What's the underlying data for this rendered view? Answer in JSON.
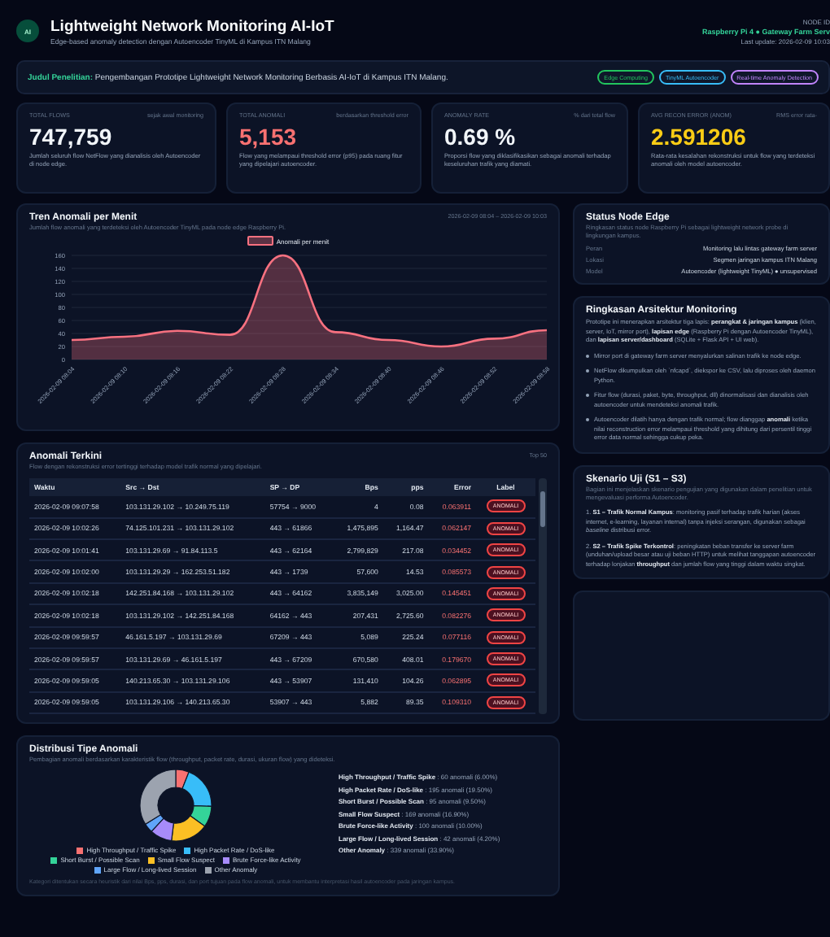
{
  "header": {
    "logo": "AI",
    "title": "Lightweight Network Monitoring AI-IoT",
    "subtitle": "Edge-based anomaly detection dengan Autoencoder TinyML di Kampus ITN Malang",
    "node_label": "NODE ID",
    "node": "Raspberry Pi 4 ● Gateway Farm Serv",
    "updated": "Last update: 2026-02-09 10:03"
  },
  "banner": {
    "text": "**Judul Penelitian:** Pengembangan Prototipe Lightweight Network Monitoring Berbasis AI-IoT di Kampus ITN Malang.",
    "tags": [
      {
        "label": "Edge Computing",
        "color": "#22c55e"
      },
      {
        "label": "TinyML Autoencoder",
        "color": "#38bdf8"
      },
      {
        "label": "Real-time Anomaly Detection",
        "color": "#c084fc"
      }
    ]
  },
  "stats": [
    {
      "label": "TOTAL FLOWS",
      "note": "sejak awal monitoring",
      "value": "747,759",
      "color": "#f1f5f9",
      "desc": "Jumlah seluruh flow NetFlow yang dianalisis oleh Autoencoder di node edge."
    },
    {
      "label": "TOTAL ANOMALI",
      "note": "berdasarkan threshold error",
      "value": "5,153",
      "color": "#f87171",
      "desc": "Flow yang melampaui threshold error (p95) pada ruang fitur yang dipelajari autoencoder."
    },
    {
      "label": "ANOMALY RATE",
      "note": "% dari total flow",
      "value": "0.69 %",
      "color": "#f1f5f9",
      "desc": "Proporsi flow yang diklasifikasikan sebagai anomali terhadap keseluruhan trafik yang diamati."
    },
    {
      "label": "AVG RECON ERROR (ANOM)",
      "note": "RMS error rata-",
      "value": "2.591206",
      "color": "#facc15",
      "desc": "Rata-rata kesalahan rekonstruksi untuk flow yang terdeteksi anomali oleh model autoencoder."
    }
  ],
  "trend": {
    "title": "Tren Anomali per Menit",
    "subtitle": "Jumlah flow anomali yang terdeteksi oleh Autoencoder TinyML pada node edge Raspberry Pi.",
    "range": "2026-02-09 08:04 – 2026-02-09 10:03",
    "chart_data": {
      "type": "area",
      "grid": true,
      "ylim": [
        0,
        160
      ],
      "yticks": [
        0,
        20,
        40,
        60,
        80,
        100,
        120,
        140,
        160
      ],
      "categories": [
        "2026-02-09 08:04",
        "2026-02-09 08:10",
        "2026-02-09 08:16",
        "2026-02-09 08:22",
        "2026-02-09 08:28",
        "2026-02-09 08:34",
        "2026-02-09 08:40",
        "2026-02-09 08:46",
        "2026-02-09 08:52",
        "2026-02-09 08:58"
      ],
      "series": [
        {
          "name": "Anomali per menit",
          "color": "#f87180",
          "values": [
            30,
            35,
            44,
            38,
            160,
            42,
            30,
            20,
            32,
            45
          ]
        }
      ]
    }
  },
  "table": {
    "title": "Anomali Terkini",
    "subtitle": "Flow dengan rekonstruksi error tertinggi terhadap model trafik normal yang dipelajari.",
    "badge": "Top 50",
    "columns": [
      "Waktu",
      "Src → Dst",
      "SP → DP",
      "Bps",
      "pps",
      "Error",
      "Label"
    ],
    "rows": [
      {
        "cells": [
          "2026-02-09 09:07:58",
          "103.131.29.102 → 10.249.75.119",
          "57754 → 9000",
          "4",
          "0.08",
          "0.063911"
        ],
        "label": "ANOMALI"
      },
      {
        "cells": [
          "2026-02-09 10:02:26",
          "74.125.101.231 → 103.131.29.102",
          "443 → 61866",
          "1,475,895",
          "1,164.47",
          "0.062147"
        ],
        "label": "ANOMALI"
      },
      {
        "cells": [
          "2026-02-09 10:01:41",
          "103.131.29.69 → 91.84.113.5",
          "443 → 62164",
          "2,799,829",
          "217.08",
          "0.034452"
        ],
        "label": "ANOMALI"
      },
      {
        "cells": [
          "2026-02-09 10:02:00",
          "103.131.29.29 → 162.253.51.182",
          "443 → 1739",
          "57,600",
          "14.53",
          "0.085573"
        ],
        "label": "ANOMALI"
      },
      {
        "cells": [
          "2026-02-09 10:02:18",
          "142.251.84.168 → 103.131.29.102",
          "443 → 64162",
          "3,835,149",
          "3,025.00",
          "0.145451"
        ],
        "label": "ANOMALI"
      },
      {
        "cells": [
          "2026-02-09 10:02:18",
          "103.131.29.102 → 142.251.84.168",
          "64162 → 443",
          "207,431",
          "2,725.60",
          "0.082276"
        ],
        "label": "ANOMALI"
      },
      {
        "cells": [
          "2026-02-09 09:59:57",
          "46.161.5.197 → 103.131.29.69",
          "67209 → 443",
          "5,089",
          "225.24",
          "0.077116"
        ],
        "label": "ANOMALI"
      },
      {
        "cells": [
          "2026-02-09 09:59:57",
          "103.131.29.69 → 46.161.5.197",
          "443 → 67209",
          "670,580",
          "408.01",
          "0.179670"
        ],
        "label": "ANOMALI"
      },
      {
        "cells": [
          "2026-02-09 09:59:05",
          "140.213.65.30 → 103.131.29.106",
          "443 → 53907",
          "131,410",
          "104.26",
          "0.062895"
        ],
        "label": "ANOMALI"
      },
      {
        "cells": [
          "2026-02-09 09:59:05",
          "103.131.29.106 → 140.213.65.30",
          "53907 → 443",
          "5,882",
          "89.35",
          "0.109310"
        ],
        "label": "ANOMALI"
      }
    ]
  },
  "distribution": {
    "title": "Distribusi Tipe Anomali",
    "subtitle": "Pembagian anomali berdasarkan karakteristik flow (throughput, packet rate, durasi, ukuran flow) yang dideteksi.",
    "legend": [
      {
        "color": "#f87171"
      },
      {
        "color": "#38bdf8"
      },
      {
        "color": "#34d399"
      },
      {
        "color": "#fbbf24"
      },
      {
        "color": "#a78bfa"
      },
      {
        "color": "#60a5fa"
      },
      {
        "color": "#9ca3af"
      }
    ],
    "details": [
      "**High Throughput / Traffic Spike** : 60 anomali (6.00%)",
      "**High Packet Rate / DoS-like** : 195 anomali (19.50%)",
      "**Short Burst / Possible Scan** : 95 anomali (9.50%)",
      "**Small Flow Suspect** : 169 anomali (16.90%)",
      "**Brute Force-like Activity** : 100 anomali (10.00%)",
      "**Large Flow / Long-lived Session** : 42 anomali (4.20%)",
      "**Other Anomaly** : 339 anomali (33.90%)"
    ],
    "note": "Kategori ditentukan secara heuristik dari nilai Bps, pps, durasi, dan port tujuan pada flow anomali, untuk membantu interpretasi hasil autoencoder pada jaringan kampus.",
    "chart_data": {
      "type": "donut",
      "categories": [
        "High Throughput / Traffic Spike",
        "High Packet Rate / DoS-like",
        "Short Burst / Possible Scan",
        "Small Flow Suspect",
        "Brute Force-like Activity",
        "Large Flow / Long-lived Session",
        "Other Anomaly"
      ],
      "values": [
        6,
        19.5,
        9.5,
        16.9,
        10,
        4.2,
        33.9
      ]
    }
  },
  "status": {
    "title": "Status Node Edge",
    "desc": "Ringkasan status node Raspberry Pi sebagai lightweight network probe di lingkungan kampus.",
    "rows": [
      {
        "key": "Peran",
        "value": "Monitoring lalu lintas gateway farm server"
      },
      {
        "key": "Lokasi",
        "value": "Segmen jaringan kampus ITN Malang"
      },
      {
        "key": "Model",
        "value": "Autoencoder (lightweight TinyML) ● unsupervised"
      }
    ]
  },
  "architecture": {
    "title": "Ringkasan Arsitektur Monitoring",
    "intro": "Prototipe ini menerapkan arsitektur tiga lapis: **perangkat & jaringan kampus** (klien, server, IoT, mirror port), **lapisan edge** (Raspberry Pi dengan Autoencoder TinyML), dan **lapisan server/dashboard** (SQLite + Flask API + UI web).",
    "bullets": [
      "Mirror port di gateway farm server menyalurkan salinan trafik ke node edge.",
      "NetFlow dikumpulkan oleh `nfcapd`, diekspor ke CSV, lalu diproses oleh daemon Python.",
      "Fitur flow (durasi, paket, byte, throughput, dll) dinormalisasi dan dianalisis oleh autoencoder untuk mendeteksi anomali trafik.",
      "Autoencoder dilatih hanya dengan trafik normal; flow dianggap **anomali** ketika nilai reconstruction error melampaui threshold yang dihitung dari persentil tinggi error data normal sehingga cukup peka."
    ]
  },
  "scenario": {
    "title": "Skenario Uji (S1 – S3)",
    "desc": "Bagian ini menjelaskan skenario pengujian yang digunakan dalam penelitian untuk mengevaluasi performa Autoencoder.",
    "items": [
      "1. **S1 – Trafik Normal Kampus**: monitoring pasif terhadap trafik harian (akses internet, e-learning, layanan internal) tanpa injeksi serangan, digunakan sebagai *baseline* distribusi error.",
      "2. **S2 – Trafik Spike Terkontrol**: peningkatan beban transfer ke server farm (unduhan/upload besar atau uji beban HTTP) untuk melihat tanggapan autoencoder terhadap lonjakan **throughput** dan jumlah flow yang tinggi dalam waktu singkat."
    ]
  }
}
